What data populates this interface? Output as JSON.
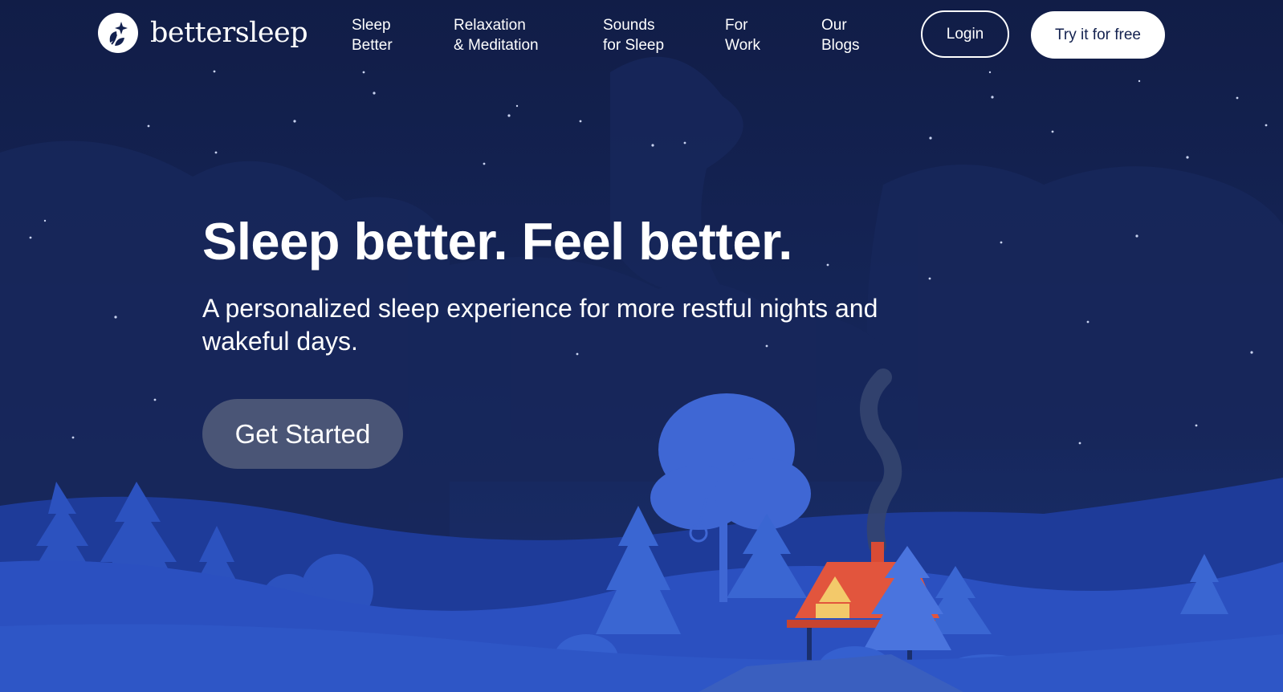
{
  "brand": {
    "name": "bettersleep"
  },
  "nav": {
    "items": [
      {
        "line1": "Sleep",
        "line2": "Better"
      },
      {
        "line1": "Relaxation",
        "line2": "& Meditation"
      },
      {
        "line1": "Sounds",
        "line2": "for Sleep"
      },
      {
        "line1": "For",
        "line2": "Work"
      },
      {
        "line1": "Our",
        "line2": "Blogs"
      }
    ],
    "login_label": "Login",
    "try_label": "Try it for free"
  },
  "hero": {
    "title": "Sleep better. Feel better.",
    "subtitle": "A personalized sleep experience for more restful nights and wakeful days.",
    "cta_label": "Get Started"
  },
  "icons": {
    "logo": "sparkle-leaf-icon"
  },
  "colors": {
    "sky": "#13214f",
    "hills_back": "#1f3c9c",
    "hills_front": "#2a53c6",
    "trees": "#3b68d6",
    "roof": "#e0533b",
    "window_light": "#f3c96a",
    "cta_bg": "#4a5576"
  }
}
